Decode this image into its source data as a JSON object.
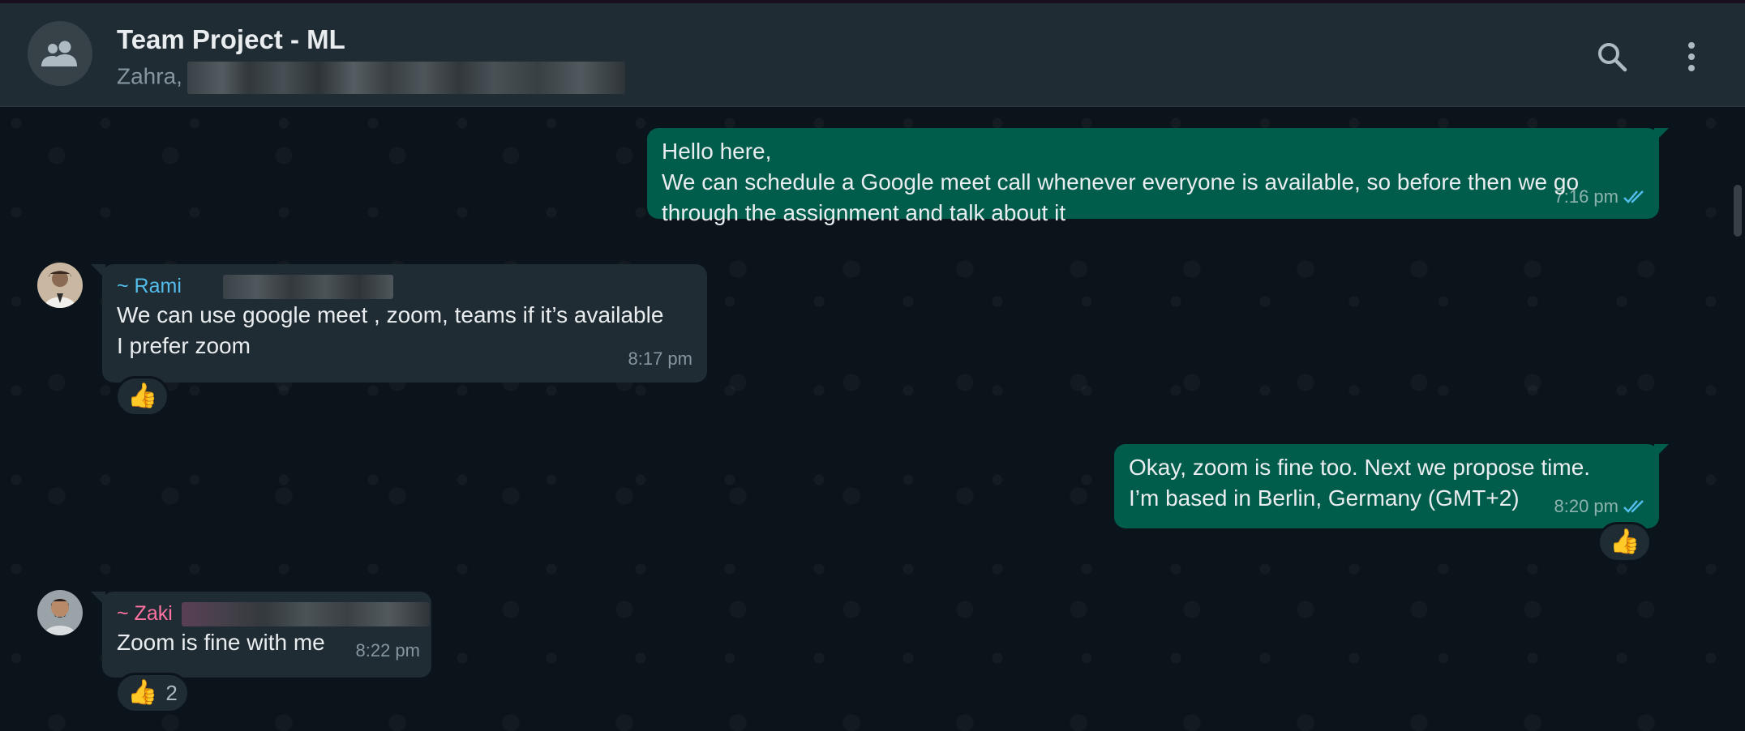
{
  "header": {
    "title": "Team Project - ML",
    "subtitle": "Zahra,",
    "icons": [
      "group-avatar-icon",
      "search-icon",
      "more-vertical-icon"
    ]
  },
  "messages": [
    {
      "direction": "outgoing",
      "lines": [
        "Hello here,",
        "We can schedule a Google meet call whenever everyone is available, so before then we go",
        "through the assignment and talk about it"
      ],
      "time": "7:16 pm",
      "status": "read"
    },
    {
      "direction": "incoming",
      "sender": "~ Rami",
      "sender_color": "#53bdeb",
      "lines": [
        "We can use google meet , zoom, teams if it’s available",
        "I prefer zoom"
      ],
      "time": "8:17 pm",
      "reaction": {
        "emoji": "👍",
        "count": ""
      }
    },
    {
      "direction": "outgoing",
      "lines": [
        "Okay, zoom is fine too. Next we propose time.",
        "I’m based in Berlin, Germany (GMT+2)"
      ],
      "time": "8:20 pm",
      "status": "read",
      "reaction": {
        "emoji": "👍",
        "count": ""
      }
    },
    {
      "direction": "incoming",
      "sender": "~ Zaki",
      "sender_color": "#ff72a1",
      "lines": [
        "Zoom is fine with me"
      ],
      "time": "8:22 pm",
      "reaction": {
        "emoji": "👍",
        "count": "2"
      }
    }
  ],
  "colors": {
    "outgoing_bubble": "#005c4b",
    "incoming_bubble": "#202c33",
    "read_ticks": "#53bdeb",
    "background": "#0b141a"
  }
}
